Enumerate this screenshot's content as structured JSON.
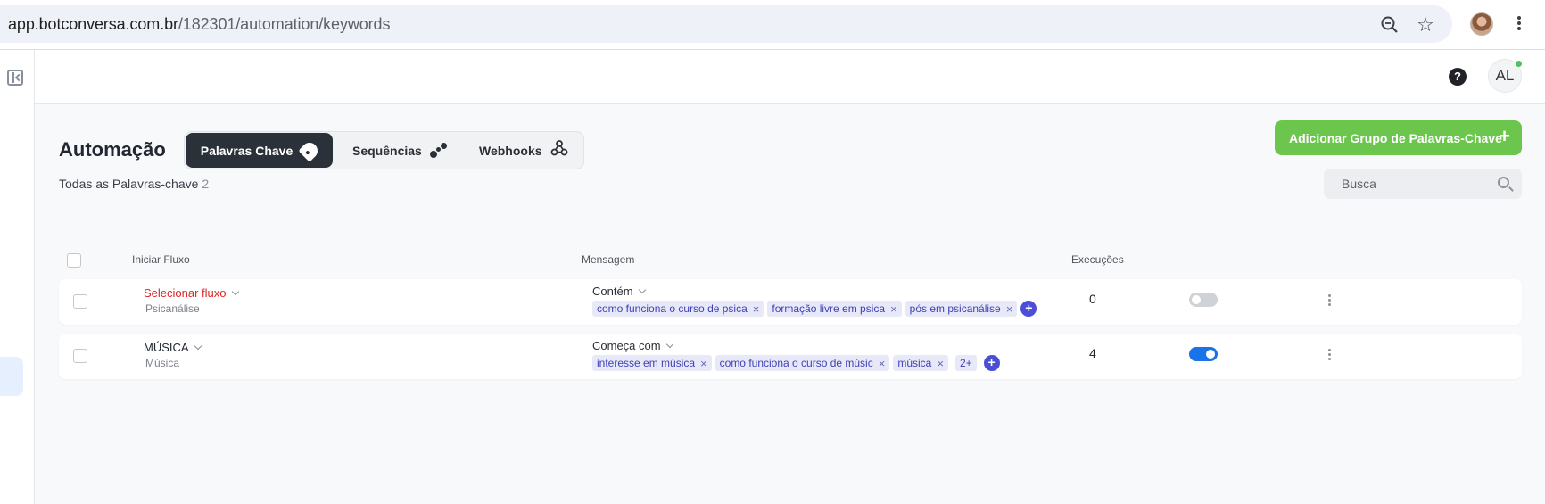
{
  "browser": {
    "url_host": "app.botconversa.com.br",
    "url_path": "/182301/automation/keywords"
  },
  "header": {
    "help_label": "?",
    "avatar_initials": "AL"
  },
  "page": {
    "title": "Automação",
    "tabs": [
      {
        "label": "Palavras Chave",
        "active": true
      },
      {
        "label": "Sequências",
        "active": false
      },
      {
        "label": "Webhooks",
        "active": false
      }
    ],
    "add_button_label": "Adicionar Grupo de Palavras-Chave",
    "subtitle": "Todas as Palavras-chave",
    "subtitle_count": "2",
    "search_placeholder": "Busca"
  },
  "table": {
    "columns": [
      "Iniciar Fluxo",
      "Mensagem",
      "Execuções"
    ],
    "rows": [
      {
        "flow": "Selecionar fluxo",
        "flow_sub": "Psicanálise",
        "condition": "Contém",
        "keywords": [
          "como funciona o curso de psica",
          "formação livre em psica",
          "pós em psicanálise"
        ],
        "more": "",
        "executions": "0",
        "enabled": false
      },
      {
        "flow": "MÚSICA",
        "flow_sub": "Música",
        "condition": "Começa com",
        "keywords": [
          "interesse em música",
          "como funciona o curso de músic",
          "música"
        ],
        "more": "2+",
        "executions": "4",
        "enabled": true
      }
    ]
  },
  "colors": {
    "primary_dark": "#2a3139",
    "add_green": "#6cc64e",
    "chip_bg": "#e8e9f8",
    "chip_text": "#3f3fb5",
    "toggle_on": "#1a73e8",
    "alert_red": "#e02424"
  }
}
